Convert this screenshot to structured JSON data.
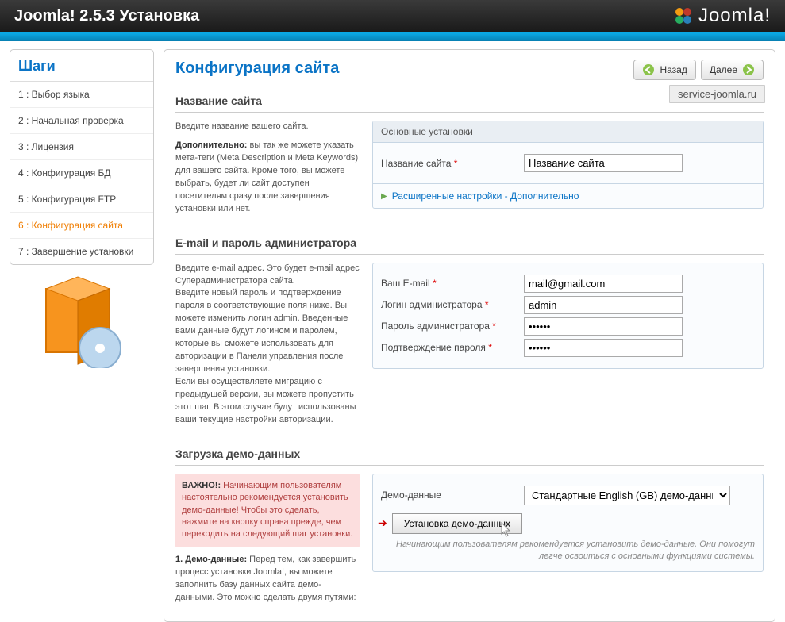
{
  "topbar": {
    "title": "Joomla! 2.5.3 Установка",
    "brand": "Joomla!"
  },
  "sidebar": {
    "title": "Шаги",
    "steps": [
      "1 : Выбор языка",
      "2 : Начальная проверка",
      "3 : Лицензия",
      "4 : Конфигурация БД",
      "5 : Конфигурация FTP",
      "6 : Конфигурация сайта",
      "7 : Завершение установки"
    ],
    "active_index": 5
  },
  "nav": {
    "back": "Назад",
    "next": "Далее"
  },
  "service_tag": "service-joomla.ru",
  "page_title": "Конфигурация сайта",
  "section_site": {
    "heading": "Название сайта",
    "desc1": "Введите название вашего сайта.",
    "desc2_bold": "Дополнительно:",
    "desc2": " вы так же можете указать мета-теги (Meta Description и Meta Keywords) для вашего сайта.\nКроме того, вы можете выбрать, будет ли сайт доступен посетителям сразу после завершения установки или нет.",
    "fs_head": "Основные установки",
    "label": "Название сайта",
    "value": "Название сайта",
    "adv_link": "Расширенные настройки - Дополнительно"
  },
  "section_admin": {
    "heading": "E-mail и пароль администратора",
    "desc": "Введите e-mail адрес. Это будет e-mail адрес Суперадминистратора сайта.\nВведите новый пароль и подтверждение пароля в соответствующие поля ниже. Вы можете изменить логин admin. Введенные вами данные будут логином и паролем, которые вы сможете использовать для авторизации в Панели управления после завершения установки.\nЕсли вы осуществляете миграцию с предыдущей версии, вы можете пропустить этот шаг. В этом случае будут использованы ваши текущие настройки авторизации.",
    "fields": {
      "email_label": "Ваш E-mail",
      "email_value": "mail@gmail.com",
      "login_label": "Логин администратора",
      "login_value": "admin",
      "pass_label": "Пароль администратора",
      "pass_value": "••••••",
      "pass2_label": "Подтверждение пароля",
      "pass2_value": "••••••"
    }
  },
  "section_demo": {
    "heading": "Загрузка демо-данных",
    "warn_bold": "ВАЖНО!:",
    "warn": " Начинающим пользователям настоятельно рекомендуется установить демо-данные! Чтобы это сделать, нажмите на кнопку справа прежде, чем переходить на следующий шаг установки.",
    "p1_bold": "1. Демо-данные:",
    "p1": " Перед тем, как завершить процесс установки Joomla!, вы можете заполнить базу данных сайта демо-данными. Это можно сделать двумя путями:",
    "select_label": "Демо-данные",
    "select_value": "Стандартные English (GB) демо-данные",
    "button": "Установка демо-данных",
    "note": "Начинающим пользователям рекомендуется установить демо-данные. Они помогут легче освоиться с основными функциями системы."
  }
}
